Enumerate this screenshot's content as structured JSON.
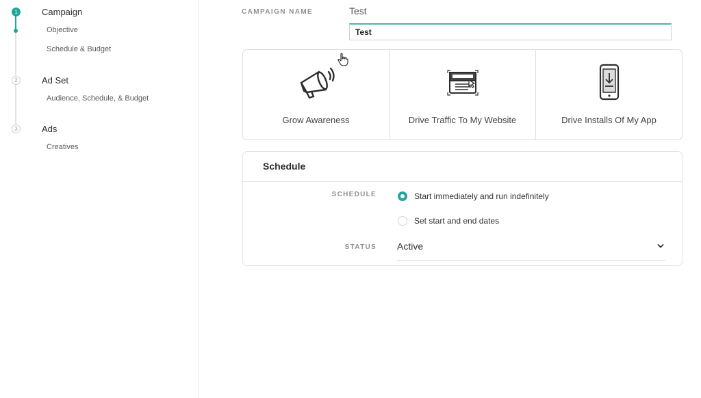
{
  "steps": [
    {
      "number": "1",
      "title": "Campaign",
      "subs": [
        "Objective",
        "Schedule & Budget"
      ]
    },
    {
      "number": "2",
      "title": "Ad Set",
      "subs": [
        "Audience, Schedule, & Budget"
      ]
    },
    {
      "number": "3",
      "title": "Ads",
      "subs": [
        "Creatives"
      ]
    }
  ],
  "campaign": {
    "name_label": "CAMPAIGN NAME",
    "name_display": "Test",
    "name_input_value": "Test"
  },
  "objectives": [
    {
      "label": "Grow Awareness",
      "icon": "megaphone-icon"
    },
    {
      "label": "Drive Traffic To My Website",
      "icon": "browser-window-icon"
    },
    {
      "label": "Drive Installs Of My App",
      "icon": "phone-download-icon"
    }
  ],
  "schedule": {
    "title": "Schedule",
    "schedule_label": "SCHEDULE",
    "options": [
      "Start immediately and run indefinitely",
      "Set start and end dates"
    ],
    "status_label": "STATUS",
    "status_value": "Active"
  },
  "colors": {
    "accent": "#1fa698",
    "border": "#dedede"
  }
}
